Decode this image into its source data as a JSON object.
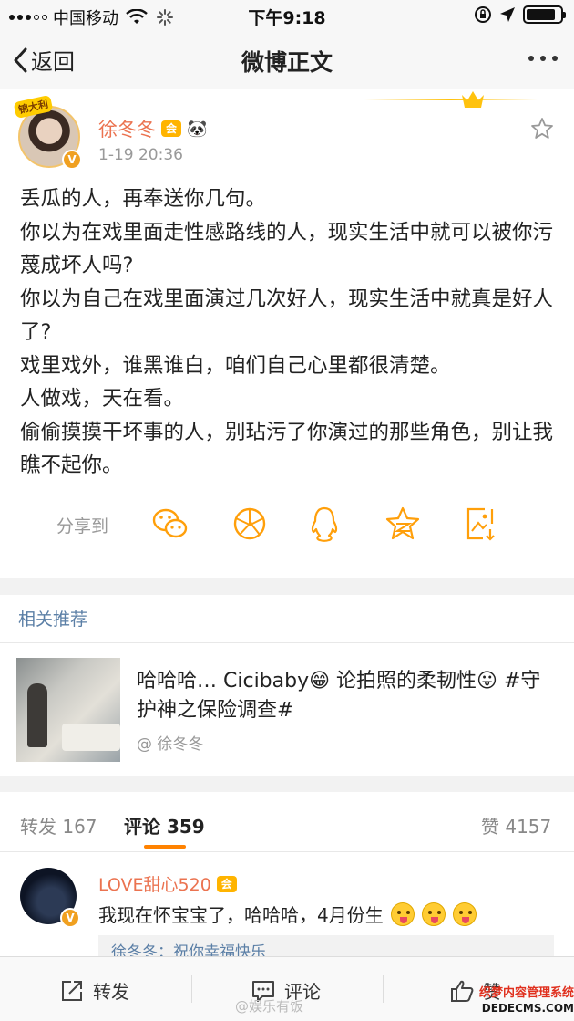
{
  "status_bar": {
    "carrier": "中国移动",
    "time": "下午9:18",
    "battery_level": 0.85
  },
  "nav": {
    "back_label": "返回",
    "title": "微博正文"
  },
  "post": {
    "author": "徐冬冬",
    "avatar_tag": "锦大利",
    "verified_badge": "V",
    "vip_badge": "会",
    "time": "1-19 20:36",
    "body": [
      "丢瓜的人，再奉送你几句。",
      "你以为在戏里面走性感路线的人，现实生活中就可以被你污蔑成坏人吗?",
      "你以为自己在戏里面演过几次好人，现实生活中就真是好人了?",
      "戏里戏外，谁黑谁白，咱们自己心里都很清楚。",
      "人做戏，天在看。",
      "偷偷摸摸干坏事的人，别玷污了你演过的那些角色，别让我瞧不起你。"
    ]
  },
  "share": {
    "label": "分享到",
    "icons": [
      "wechat-icon",
      "moments-icon",
      "qq-icon",
      "qzone-icon",
      "save-image-icon"
    ],
    "accent": "#ff9f0a"
  },
  "related": {
    "title": "相关推荐",
    "card_text": "哈哈哈… Cicibaby😁 论拍照的柔韧性😛 #守护神之保险调查#",
    "card_author": "@ 徐冬冬"
  },
  "tabs": {
    "repost": "转发 167",
    "comment": "评论 359",
    "like": "赞 4157"
  },
  "comment": {
    "user": "LOVE甜心520",
    "text": "我现在怀宝宝了，哈哈哈，4月份生",
    "reply_preview": "徐冬冬：祝你幸福快乐"
  },
  "bottom_bar": {
    "repost": "转发",
    "comment": "评论",
    "like": "赞"
  },
  "watermarks": {
    "center": "@娱乐有饭",
    "right_line1": "织梦内容管理系统",
    "right_line2": "DEDECMS.COM"
  },
  "colors": {
    "username": "#eb7350",
    "link_blue": "#5b7fa6",
    "tab_indicator": "#ff8200",
    "crown_gold": "#ffc20e"
  }
}
